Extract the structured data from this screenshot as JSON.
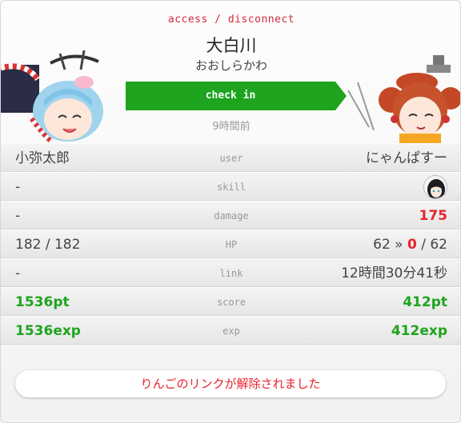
{
  "header": {
    "access_label": "access",
    "separator": "/",
    "disconnect_label": "disconnect",
    "spot_name": "大白川",
    "spot_kana": "おおしらかわ",
    "checkin_label": "check in",
    "time_ago": "9時間前"
  },
  "colors": {
    "accent_red": "#e8222b",
    "accent_green": "#1ea41e"
  },
  "rows": [
    {
      "left": "小弥太郎",
      "label": "user",
      "right": "にゃんぱすー"
    },
    {
      "left": "-",
      "label": "skill",
      "right_icon": "character-portrait-icon"
    },
    {
      "left": "-",
      "label": "damage",
      "right": "175"
    },
    {
      "left": "182 / 182",
      "label": "HP",
      "right_prefix": "62 » ",
      "right_highlight": "0",
      "right_suffix": " / 62"
    },
    {
      "left": "-",
      "label": "link",
      "right": "12時間30分41秒"
    },
    {
      "left": "1536pt",
      "label": "score",
      "right": "412pt"
    },
    {
      "left": "1536exp",
      "label": "exp",
      "right": "412exp"
    }
  ],
  "notice": "りんごのリンクが解除されました"
}
